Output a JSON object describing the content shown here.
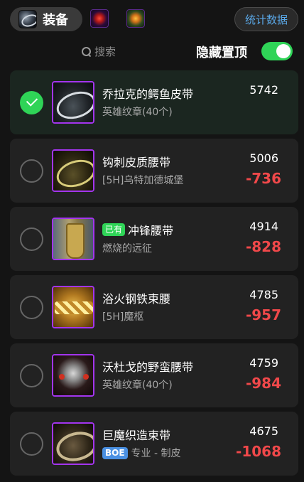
{
  "header": {
    "tab_label": "装备",
    "stats_button": "统计数据"
  },
  "search": {
    "placeholder": "搜索"
  },
  "hide_top": {
    "label": "隐藏置顶",
    "enabled": true
  },
  "items": [
    {
      "name": "乔拉克的鳄鱼皮带",
      "source": "英雄纹章(40个)",
      "score": "5742",
      "diff": "",
      "checked": true,
      "owned": false,
      "boe": false,
      "icon": "crocodile-leather-belt-icon"
    },
    {
      "name": "钩刺皮质腰带",
      "source": "[5H]乌特加德城堡",
      "score": "5006",
      "diff": "-736",
      "checked": false,
      "owned": false,
      "boe": false,
      "icon": "barbed-leather-belt-icon"
    },
    {
      "name": "冲锋腰带",
      "source": "燃烧的远征",
      "score": "4914",
      "diff": "-828",
      "checked": false,
      "owned": true,
      "owned_label": "已有",
      "boe": false,
      "icon": "charge-belt-icon"
    },
    {
      "name": "浴火钢铁束腰",
      "source": "[5H]魔枢",
      "score": "4785",
      "diff": "-957",
      "checked": false,
      "owned": false,
      "boe": false,
      "icon": "fire-steel-girdle-icon"
    },
    {
      "name": "沃杜戈的野蛮腰带",
      "source": "英雄纹章(40个)",
      "score": "4759",
      "diff": "-984",
      "checked": false,
      "owned": false,
      "boe": false,
      "icon": "savage-belt-icon"
    },
    {
      "name": "巨魔织造束带",
      "source": "专业 - 制皮",
      "score": "4675",
      "diff": "-1068",
      "checked": false,
      "owned": false,
      "boe": true,
      "boe_label": "BOE",
      "icon": "troll-woven-belt-icon"
    }
  ],
  "colors": {
    "accent_green": "#2fd457",
    "diff_red": "#f0484a",
    "link_blue": "#5aa8e8",
    "epic_border": "#a335ee"
  }
}
